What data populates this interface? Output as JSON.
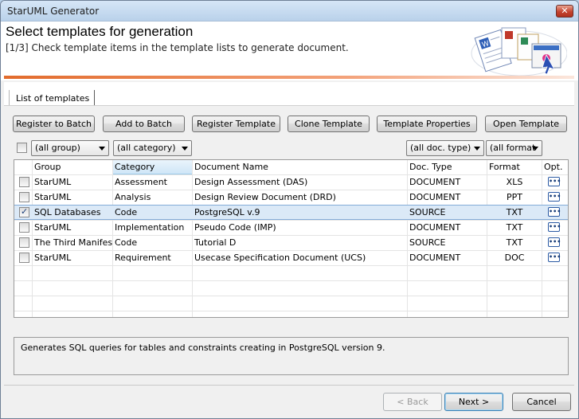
{
  "window": {
    "title": "StarUML Generator",
    "close_glyph": "✕"
  },
  "header": {
    "title": "Select templates for generation",
    "subtitle": "[1/3] Check template items in the template lists to generate document.",
    "graphic": "documents-with-cursor-icon"
  },
  "tab": {
    "label": "List of templates"
  },
  "toolbar": {
    "register_to_batch": "Register to Batch",
    "add_to_batch": "Add to Batch",
    "register_template": "Register Template",
    "clone_template": "Clone Template",
    "template_properties": "Template Properties",
    "open_template": "Open Template"
  },
  "filters": {
    "group": "(all group)",
    "category": "(all category)",
    "doc_type": "(all doc. type)",
    "format": "(all format"
  },
  "grid": {
    "columns": {
      "group": "Group",
      "category": "Category",
      "document_name": "Document Name",
      "doc_type": "Doc. Type",
      "format": "Format",
      "opt": "Opt."
    },
    "rows": [
      {
        "checked": false,
        "group": "StarUML",
        "category": "Assessment",
        "document_name": "Design Assessment (DAS)",
        "doc_type": "DOCUMENT",
        "format": "XLS"
      },
      {
        "checked": false,
        "group": "StarUML",
        "category": "Analysis",
        "document_name": "Design Review Document (DRD)",
        "doc_type": "DOCUMENT",
        "format": "PPT"
      },
      {
        "checked": true,
        "group": "SQL Databases",
        "category": "Code",
        "document_name": "PostgreSQL v.9",
        "doc_type": "SOURCE",
        "format": "TXT"
      },
      {
        "checked": false,
        "group": "StarUML",
        "category": "Implementation",
        "document_name": "Pseudo Code (IMP)",
        "doc_type": "DOCUMENT",
        "format": "TXT"
      },
      {
        "checked": false,
        "group": "The Third Manifesto",
        "category": "Code",
        "document_name": "Tutorial D",
        "doc_type": "SOURCE",
        "format": "TXT"
      },
      {
        "checked": false,
        "group": "StarUML",
        "category": "Requirement",
        "document_name": "Usecase Specification Document (UCS)",
        "doc_type": "DOCUMENT",
        "format": "DOC"
      }
    ],
    "opt_glyph": "•••"
  },
  "description": "Generates SQL queries for tables and constraints creating in PostgreSQL version 9.",
  "footer": {
    "back": "< Back",
    "next": "Next >",
    "cancel": "Cancel"
  },
  "colors": {
    "accent": "#e26b2c",
    "selection": "#dbe9f7",
    "titlebar": "#b9d1ea"
  }
}
